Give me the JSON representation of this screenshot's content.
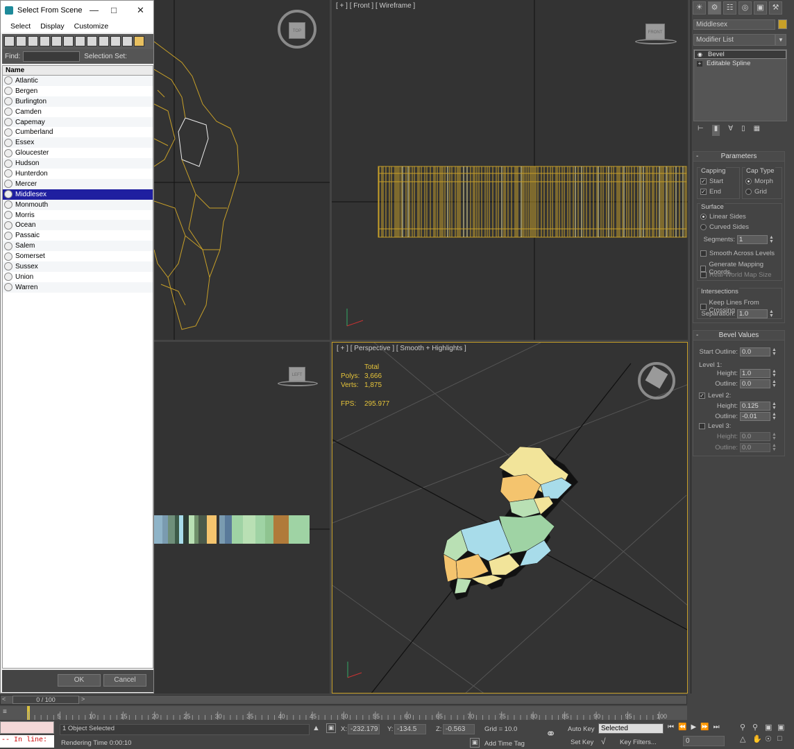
{
  "dialog": {
    "title": "Select From Scene",
    "menu": [
      "Select",
      "Display",
      "Customize"
    ],
    "find_label": "Find:",
    "selection_set_label": "Selection Set:",
    "list_header": "Name",
    "items": [
      "Atlantic",
      "Bergen",
      "Burlington",
      "Camden",
      "Capemay",
      "Cumberland",
      "Essex",
      "Gloucester",
      "Hudson",
      "Hunterdon",
      "Mercer",
      "Middlesex",
      "Monmouth",
      "Morris",
      "Ocean",
      "Passaic",
      "Salem",
      "Somerset",
      "Sussex",
      "Union",
      "Warren"
    ],
    "selected_item": "Middlesex",
    "ok_label": "OK",
    "cancel_label": "Cancel"
  },
  "viewports": {
    "top": {
      "cube_label": "TOP"
    },
    "front": {
      "label": "[ + ] [ Front ] [ Wireframe ]",
      "cube_label": "FRONT"
    },
    "left": {
      "cube_label": "LEFT"
    },
    "perspective": {
      "label": "[ + ] [ Perspective ] [ Smooth + Highlights ]",
      "stats_header": "Total",
      "polys_label": "Polys:",
      "polys_value": "3,666",
      "verts_label": "Verts:",
      "verts_value": "1,875",
      "fps_label": "FPS:",
      "fps_value": "295.977"
    }
  },
  "command_panel": {
    "object_name": "Middlesex",
    "object_color": "#c8a028",
    "modifier_list_label": "Modifier List",
    "stack": [
      "Bevel",
      "Editable Spline"
    ],
    "parameters": {
      "title": "Parameters",
      "capping_title": "Capping",
      "cap_start": "Start",
      "cap_end": "End",
      "cap_type_title": "Cap Type",
      "morph": "Morph",
      "grid": "Grid",
      "surface_title": "Surface",
      "linear_sides": "Linear Sides",
      "curved_sides": "Curved Sides",
      "segments_label": "Segments:",
      "segments_value": "1",
      "smooth_across": "Smooth Across Levels",
      "gen_mapping": "Generate Mapping Coords.",
      "real_world": "Real-World Map Size",
      "intersections_title": "Intersections",
      "keep_lines": "Keep Lines From Crossing",
      "separation_label": "Separation:",
      "separation_value": "1.0"
    },
    "bevel_values": {
      "title": "Bevel Values",
      "start_outline_label": "Start Outline:",
      "start_outline_value": "0.0",
      "level1_label": "Level 1:",
      "l1_height_value": "1.0",
      "l1_outline_value": "0.0",
      "level2_label": "Level 2:",
      "l2_height_value": "0.125",
      "l2_outline_value": "-0.01",
      "level3_label": "Level 3:",
      "l3_height_value": "0.0",
      "l3_outline_value": "0.0",
      "height_label": "Height:",
      "outline_label": "Outline:"
    }
  },
  "timeline": {
    "frame_counter": "0 / 100",
    "ticks": [
      "0",
      "5",
      "10",
      "15",
      "20",
      "25",
      "30",
      "35",
      "40",
      "45",
      "50",
      "55",
      "60",
      "65",
      "70",
      "75",
      "80",
      "85",
      "90",
      "95",
      "100"
    ]
  },
  "status": {
    "maxscript_prompt": "-- In line:",
    "selection": "1 Object Selected",
    "rendering_time": "Rendering Time  0:00:10",
    "x_label": "X:",
    "x_value": "-232.179",
    "y_label": "Y:",
    "y_value": "-134.5",
    "z_label": "Z:",
    "z_value": "-0.563",
    "grid": "Grid = 10.0",
    "add_time_tag": "Add Time Tag",
    "auto_key": "Auto Key",
    "set_key": "Set Key",
    "key_mode": "Selected",
    "key_filters": "Key Filters...",
    "frame_value": "0"
  }
}
